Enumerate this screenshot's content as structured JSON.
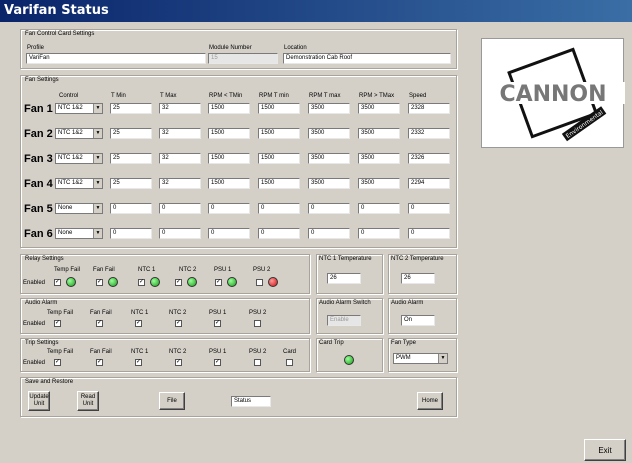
{
  "window": {
    "title": "Varifan Status"
  },
  "fan_control": {
    "title": "Fan Control Card Settings",
    "profile_label": "Profile",
    "profile_value": "VariFan",
    "module_label": "Module Number",
    "module_value": "15",
    "location_label": "Location",
    "location_value": "Demonstration Cab Roof"
  },
  "fan_settings": {
    "title": "Fan Settings",
    "headers": [
      "Control",
      "T Min",
      "T Max",
      "RPM < TMin",
      "RPM T min",
      "RPM T max",
      "RPM > TMax",
      "Speed"
    ],
    "rows": [
      {
        "name": "Fan 1",
        "control": "NTC 1&2",
        "tmin": "25",
        "tmax": "32",
        "rpm_lt_tmin": "1500",
        "rpm_tmin": "1500",
        "rpm_tmax": "3500",
        "rpm_gt_tmax": "3500",
        "speed": "2328"
      },
      {
        "name": "Fan 2",
        "control": "NTC 1&2",
        "tmin": "25",
        "tmax": "32",
        "rpm_lt_tmin": "1500",
        "rpm_tmin": "1500",
        "rpm_tmax": "3500",
        "rpm_gt_tmax": "3500",
        "speed": "2332"
      },
      {
        "name": "Fan 3",
        "control": "NTC 1&2",
        "tmin": "25",
        "tmax": "32",
        "rpm_lt_tmin": "1500",
        "rpm_tmin": "1500",
        "rpm_tmax": "3500",
        "rpm_gt_tmax": "3500",
        "speed": "2326"
      },
      {
        "name": "Fan 4",
        "control": "NTC 1&2",
        "tmin": "25",
        "tmax": "32",
        "rpm_lt_tmin": "1500",
        "rpm_tmin": "1500",
        "rpm_tmax": "3500",
        "rpm_gt_tmax": "3500",
        "speed": "2294"
      },
      {
        "name": "Fan 5",
        "control": "None",
        "tmin": "0",
        "tmax": "0",
        "rpm_lt_tmin": "0",
        "rpm_tmin": "0",
        "rpm_tmax": "0",
        "rpm_gt_tmax": "0",
        "speed": "0"
      },
      {
        "name": "Fan 6",
        "control": "None",
        "tmin": "0",
        "tmax": "0",
        "rpm_lt_tmin": "0",
        "rpm_tmin": "0",
        "rpm_tmax": "0",
        "rpm_gt_tmax": "0",
        "speed": "0"
      }
    ]
  },
  "relay": {
    "title": "Relay Settings",
    "enabled_label": "Enabled",
    "items": [
      {
        "label": "Temp Fail",
        "checked": true,
        "status": "green"
      },
      {
        "label": "Fan Fail",
        "checked": true,
        "status": "green"
      },
      {
        "label": "NTC 1",
        "checked": true,
        "status": "green"
      },
      {
        "label": "NTC 2",
        "checked": true,
        "status": "green"
      },
      {
        "label": "PSU 1",
        "checked": true,
        "status": "green"
      },
      {
        "label": "PSU 2",
        "checked": false,
        "status": "red"
      }
    ]
  },
  "ntc": {
    "ntc1_label": "NTC 1 Temperature",
    "ntc1_value": "26",
    "ntc2_label": "NTC 2 Temperature",
    "ntc2_value": "26"
  },
  "audio": {
    "title": "Audio Alarm",
    "enabled_label": "Enabled",
    "items": [
      {
        "label": "Temp Fail",
        "checked": true
      },
      {
        "label": "Fan Fail",
        "checked": true
      },
      {
        "label": "NTC 1",
        "checked": true
      },
      {
        "label": "NTC 2",
        "checked": true
      },
      {
        "label": "PSU 1",
        "checked": true
      },
      {
        "label": "PSU 2",
        "checked": false
      }
    ],
    "switch_label": "Audio Alarm Switch",
    "switch_value": "Enable",
    "alarm_label": "Audio Alarm",
    "alarm_value": "On"
  },
  "trip": {
    "title": "Trip Settings",
    "enabled_label": "Enabled",
    "items": [
      {
        "label": "Temp Fail",
        "checked": true
      },
      {
        "label": "Fan Fail",
        "checked": true
      },
      {
        "label": "NTC 1",
        "checked": true
      },
      {
        "label": "NTC 2",
        "checked": true
      },
      {
        "label": "PSU 1",
        "checked": true
      },
      {
        "label": "PSU 2",
        "checked": false
      },
      {
        "label": "Card",
        "checked": false
      }
    ],
    "card_trip_label": "Card Trip",
    "card_trip_status": "green",
    "fan_type_label": "Fan Type",
    "fan_type_value": "PWM"
  },
  "save": {
    "title": "Save and Restore",
    "update": "Update\nUnit",
    "read": "Read\nUnit",
    "file": "File",
    "status": "Status",
    "home": "Home"
  },
  "logo": {
    "text": "CANNON",
    "sub": "Environmental"
  },
  "exit": "Exit",
  "colors": {
    "title_start": "#0a246a",
    "title_end": "#3a6ea5",
    "led_green": "#1a9e1a",
    "led_red": "#d01010"
  }
}
